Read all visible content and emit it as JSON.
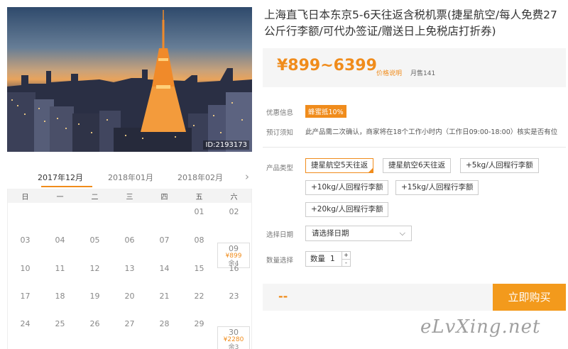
{
  "hero": {
    "image_id": "ID:2193173"
  },
  "calendar": {
    "months": [
      "2017年12月",
      "2018年01月",
      "2018年02月"
    ],
    "active_month_index": 0,
    "next_icon": "chevron-right-icon",
    "weekdays": [
      "日",
      "一",
      "二",
      "三",
      "四",
      "五",
      "六"
    ],
    "rows": [
      [
        {
          "d": ""
        },
        {
          "d": ""
        },
        {
          "d": ""
        },
        {
          "d": ""
        },
        {
          "d": ""
        },
        {
          "d": "01"
        },
        {
          "d": "02"
        }
      ],
      [
        {
          "d": "03"
        },
        {
          "d": "04"
        },
        {
          "d": "05"
        },
        {
          "d": "06"
        },
        {
          "d": "07"
        },
        {
          "d": "08"
        },
        {
          "d": "09",
          "price": "¥899",
          "remain": "余4"
        }
      ],
      [
        {
          "d": "10"
        },
        {
          "d": "11"
        },
        {
          "d": "12"
        },
        {
          "d": "13"
        },
        {
          "d": "14"
        },
        {
          "d": "15"
        },
        {
          "d": "16"
        }
      ],
      [
        {
          "d": "17"
        },
        {
          "d": "18"
        },
        {
          "d": "19"
        },
        {
          "d": "20"
        },
        {
          "d": "21"
        },
        {
          "d": "22"
        },
        {
          "d": "23"
        }
      ],
      [
        {
          "d": "24"
        },
        {
          "d": "25"
        },
        {
          "d": "26"
        },
        {
          "d": "27"
        },
        {
          "d": "28"
        },
        {
          "d": "29"
        },
        {
          "d": "30",
          "price": "¥2280",
          "remain": "余3"
        }
      ]
    ]
  },
  "product": {
    "title": "上海直飞日本东京5-6天往返含税机票(捷星航空/每人免费27公斤行李额/可代办签证/赠送日上免税店打折券)",
    "price": "¥899~6399",
    "price_note": "价格说明",
    "sold": "月售141"
  },
  "info": {
    "promo_label": "优惠信息",
    "promo_badge": "蜂蜜抵10%",
    "notice_label": "预订须知",
    "notice_text": "此产品需二次确认，商家将在18个工作小时内（工作日09:00-18:00）核实是否有位"
  },
  "options": {
    "label": "产品类型",
    "items": [
      {
        "label": "捷星航空5天往返",
        "selected": true
      },
      {
        "label": "捷星航空6天往返",
        "selected": false
      },
      {
        "label": "+5kg/人回程行李额",
        "selected": false
      },
      {
        "label": "+10kg/人回程行李额",
        "selected": false
      },
      {
        "label": "+15kg/人回程行李额",
        "selected": false
      },
      {
        "label": "+20kg/人回程行李额",
        "selected": false
      }
    ]
  },
  "date_select": {
    "label": "选择日期",
    "value": "请选择日期",
    "icon": "chevron-down-icon"
  },
  "quantity": {
    "label": "数量选择",
    "inner_label": "数量",
    "value": "1",
    "plus": "+",
    "minus": "-"
  },
  "buy": {
    "total": "--",
    "button": "立即购买"
  },
  "watermark": "eLvXing.net",
  "colors": {
    "accent": "#f08c1c",
    "button": "#f39a1c",
    "panel": "#f5f5f5"
  }
}
